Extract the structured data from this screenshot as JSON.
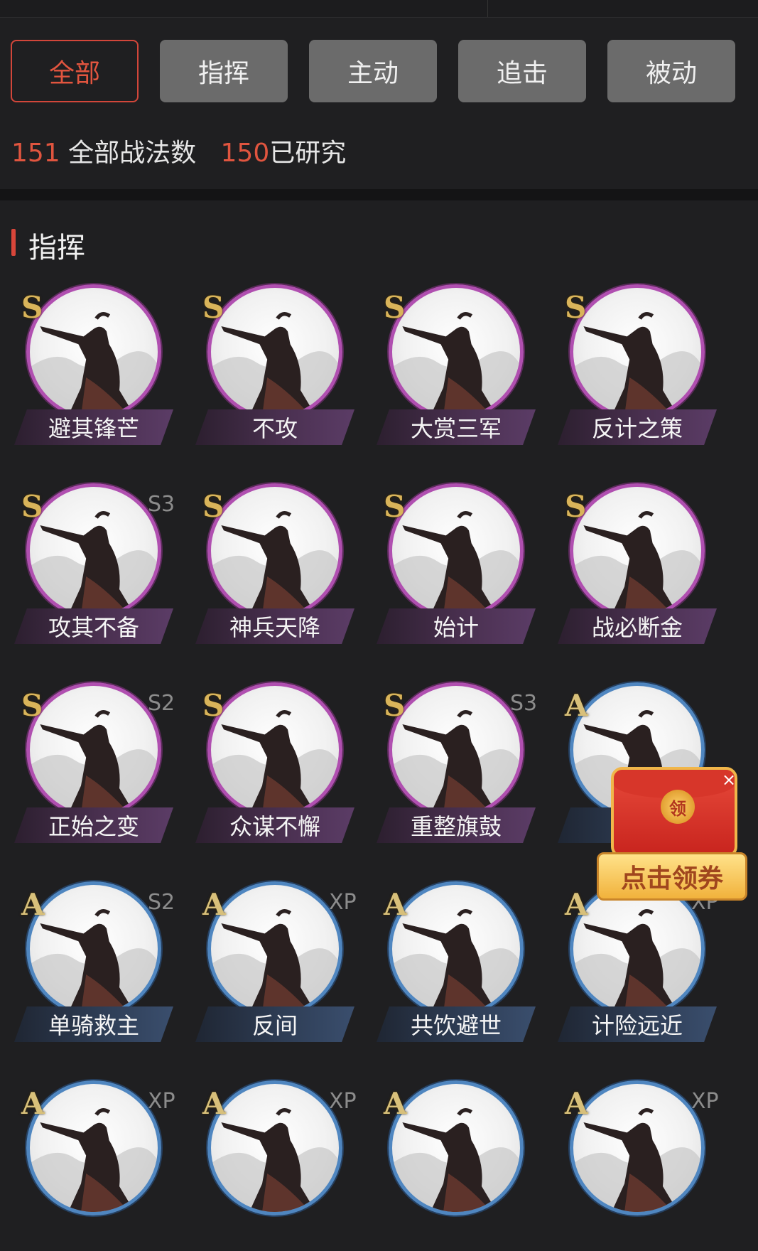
{
  "tabs": [
    {
      "label": "全部",
      "active": true
    },
    {
      "label": "指挥",
      "active": false
    },
    {
      "label": "主动",
      "active": false
    },
    {
      "label": "追击",
      "active": false
    },
    {
      "label": "被动",
      "active": false
    }
  ],
  "stats": {
    "total_num": "151",
    "total_label": "全部战法数",
    "researched_num": "150",
    "researched_label": "已研究"
  },
  "section": {
    "title": "指挥"
  },
  "skills": [
    {
      "name": "避其锋芒",
      "grade": "S",
      "season": ""
    },
    {
      "name": "不攻",
      "grade": "S",
      "season": ""
    },
    {
      "name": "大赏三军",
      "grade": "S",
      "season": ""
    },
    {
      "name": "反计之策",
      "grade": "S",
      "season": ""
    },
    {
      "name": "攻其不备",
      "grade": "S",
      "season": "S3"
    },
    {
      "name": "神兵天降",
      "grade": "S",
      "season": ""
    },
    {
      "name": "始计",
      "grade": "S",
      "season": ""
    },
    {
      "name": "战必断金",
      "grade": "S",
      "season": ""
    },
    {
      "name": "正始之变",
      "grade": "S",
      "season": "S2"
    },
    {
      "name": "众谋不懈",
      "grade": "S",
      "season": ""
    },
    {
      "name": "重整旗鼓",
      "grade": "S",
      "season": "S3"
    },
    {
      "name": "",
      "grade": "A",
      "season": ""
    },
    {
      "name": "单骑救主",
      "grade": "A",
      "season": "S2"
    },
    {
      "name": "反间",
      "grade": "A",
      "season": "XP"
    },
    {
      "name": "共饮避世",
      "grade": "A",
      "season": ""
    },
    {
      "name": "计险远近",
      "grade": "A",
      "season": "XP"
    },
    {
      "name": "",
      "grade": "A",
      "season": "XP"
    },
    {
      "name": "",
      "grade": "A",
      "season": "XP"
    },
    {
      "name": "",
      "grade": "A",
      "season": ""
    },
    {
      "name": "",
      "grade": "A",
      "season": "XP"
    }
  ],
  "ad": {
    "coin": "领",
    "button": "点击领券",
    "close": "×"
  },
  "colors": {
    "accent": "#d8463a",
    "grade_s_ring": "#b04fb0",
    "grade_a_ring": "#4f86c0"
  }
}
